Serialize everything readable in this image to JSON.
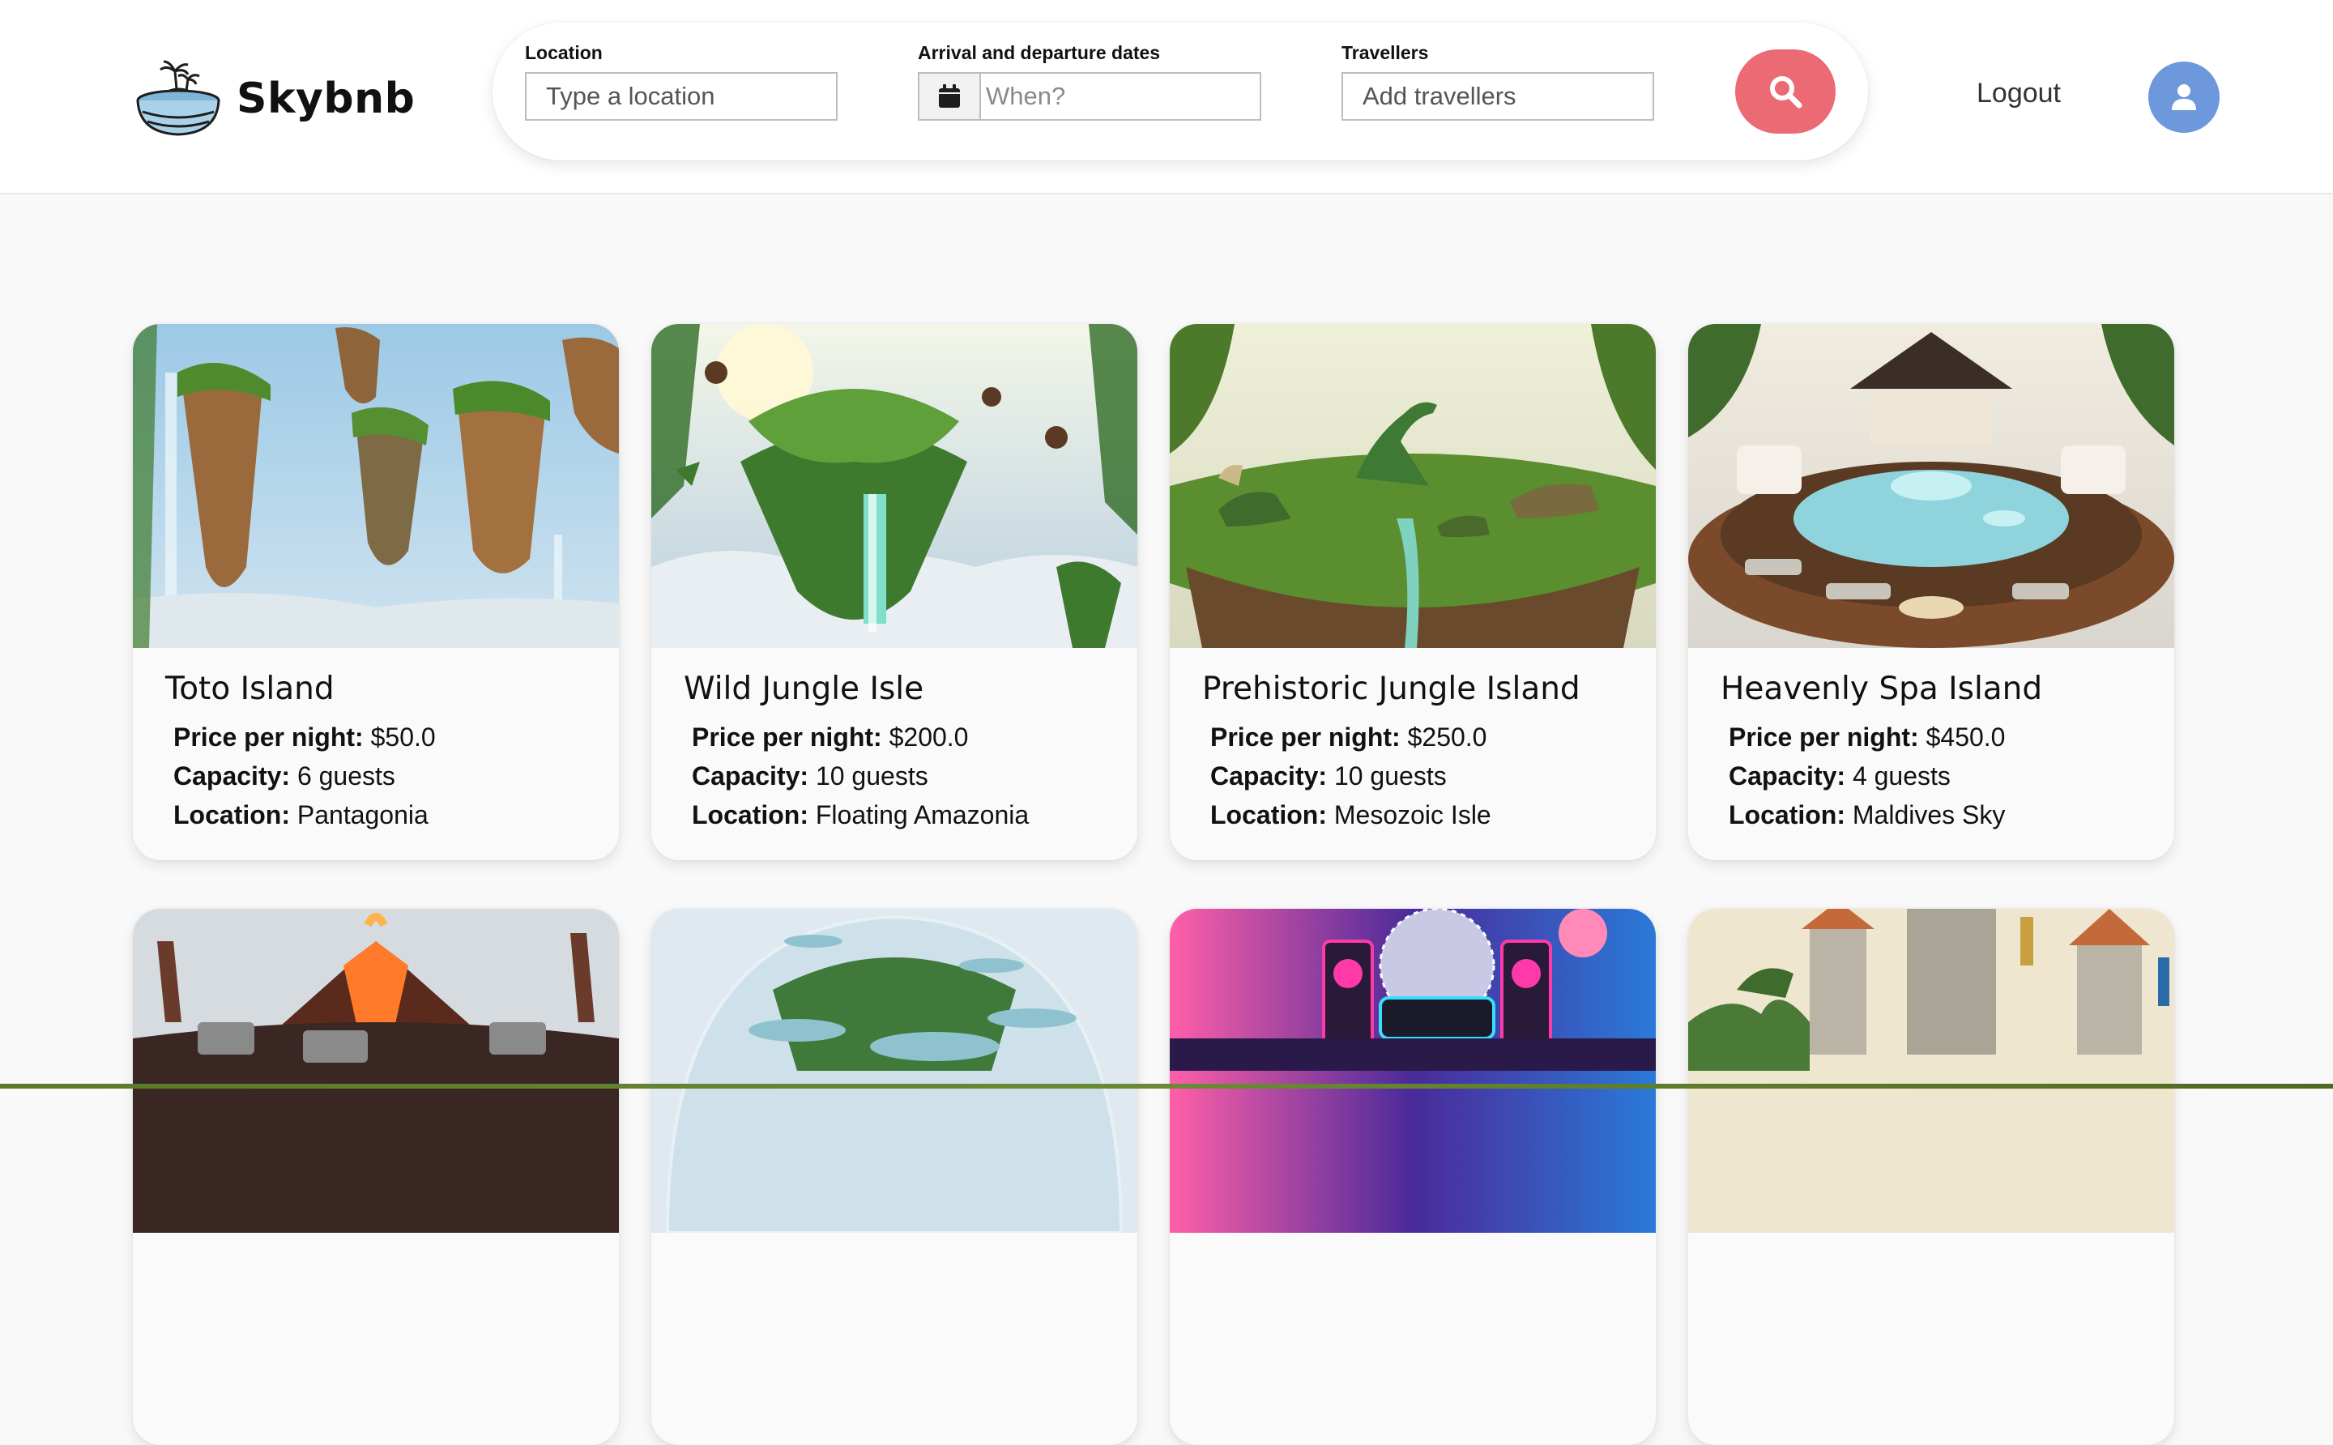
{
  "header": {
    "brand": "Skybnb",
    "logout_label": "Logout"
  },
  "search": {
    "location": {
      "label": "Location",
      "placeholder": "Type a location",
      "value": ""
    },
    "dates": {
      "label": "Arrival and departure dates",
      "placeholder": "When?",
      "value": ""
    },
    "travellers": {
      "label": "Travellers",
      "placeholder": "Add travellers",
      "value": ""
    }
  },
  "labels": {
    "price": "Price per night:",
    "capacity": "Capacity:",
    "location": "Location:"
  },
  "listings": [
    {
      "name": "Toto Island",
      "price": "$50.0",
      "capacity": "6 guests",
      "location": "Pantagonia",
      "image": "floating-cliff-islands"
    },
    {
      "name": "Wild Jungle Isle",
      "price": "$200.0",
      "capacity": "10 guests",
      "location": "Floating Amazonia",
      "image": "jungle-waterfall-monkeys"
    },
    {
      "name": "Prehistoric Jungle Island",
      "price": "$250.0",
      "capacity": "10 guests",
      "location": "Mesozoic Isle",
      "image": "dinosaur-island"
    },
    {
      "name": "Heavenly Spa Island",
      "price": "$450.0",
      "capacity": "4 guests",
      "location": "Maldives Sky",
      "image": "spa-pool-island"
    },
    {
      "image": "volcano-bbq-island"
    },
    {
      "image": "glass-dome-island"
    },
    {
      "image": "disco-party-island"
    },
    {
      "image": "castle-dragon-island"
    }
  ],
  "colors": {
    "search_button": "#eb6a74",
    "avatar": "#6d98dc",
    "page_bg": "#f9f9f9"
  },
  "icons": {
    "search": "magnifier-icon",
    "calendar": "calendar-icon",
    "user": "user-icon"
  }
}
